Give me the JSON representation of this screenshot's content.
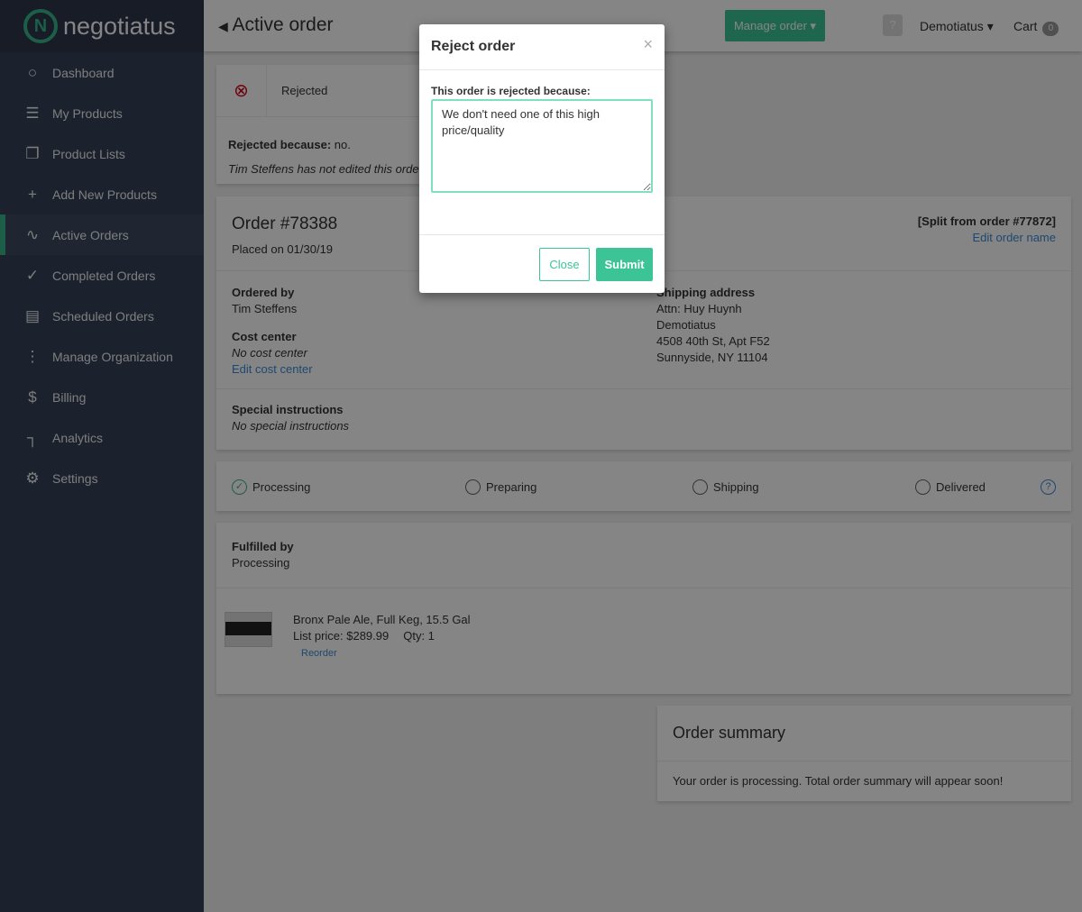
{
  "brand": {
    "name": "negotiatus",
    "mark": "N"
  },
  "sidebar": {
    "items": [
      {
        "label": "Dashboard",
        "icon": "○"
      },
      {
        "label": "My Products",
        "icon": "☰"
      },
      {
        "label": "Product Lists",
        "icon": "❐"
      },
      {
        "label": "Add New Products",
        "icon": "+"
      },
      {
        "label": "Active Orders",
        "icon": "∿"
      },
      {
        "label": "Completed Orders",
        "icon": "✓"
      },
      {
        "label": "Scheduled Orders",
        "icon": "▤"
      },
      {
        "label": "Manage Organization",
        "icon": "⋮"
      },
      {
        "label": "Billing",
        "icon": "$"
      },
      {
        "label": "Analytics",
        "icon": "┐"
      },
      {
        "label": "Settings",
        "icon": "⚙"
      }
    ]
  },
  "header": {
    "title": "Active order",
    "manage": "Manage order ▾",
    "help": "?",
    "user": "Demotiatus ▾",
    "cart": "Cart",
    "cart_count": "0"
  },
  "status": {
    "label": "Rejected",
    "reason_label": "Rejected because:",
    "reason": "no.",
    "note": "Tim Steffens has not edited this order"
  },
  "order": {
    "title": "Order #78388",
    "placed": "Placed on 01/30/19",
    "split": "[Split from order #77872]",
    "edit_name": "Edit order name",
    "ordered_by_label": "Ordered by",
    "ordered_by": "Tim Steffens",
    "cost_center_label": "Cost center",
    "cost_center": "No cost center",
    "edit_cost": "Edit cost center",
    "special_label": "Special instructions",
    "special": "No special instructions",
    "shipping_label": "Shipping address",
    "shipping": [
      "Attn: Huy Huynh",
      "Demotiatus",
      "4508 40th St, Apt F52",
      "Sunnyside, NY 11104"
    ]
  },
  "steps": [
    "Processing",
    "Preparing",
    "Shipping",
    "Delivered"
  ],
  "fulfilled": {
    "label": "Fulfilled by",
    "value": "Processing"
  },
  "item": {
    "name": "Bronx Pale Ale, Full Keg, 15.5 Gal",
    "price": "List price: $289.99",
    "qty": "Qty: 1",
    "reorder": "Reorder"
  },
  "summary": {
    "title": "Order summary",
    "text": "Your order is processing. Total order summary will appear soon!"
  },
  "modal": {
    "title": "Reject order",
    "close_x": "×",
    "label": "This order is rejected because:",
    "value": "We don't need one of this high price/quality",
    "close": "Close",
    "submit": "Submit"
  }
}
